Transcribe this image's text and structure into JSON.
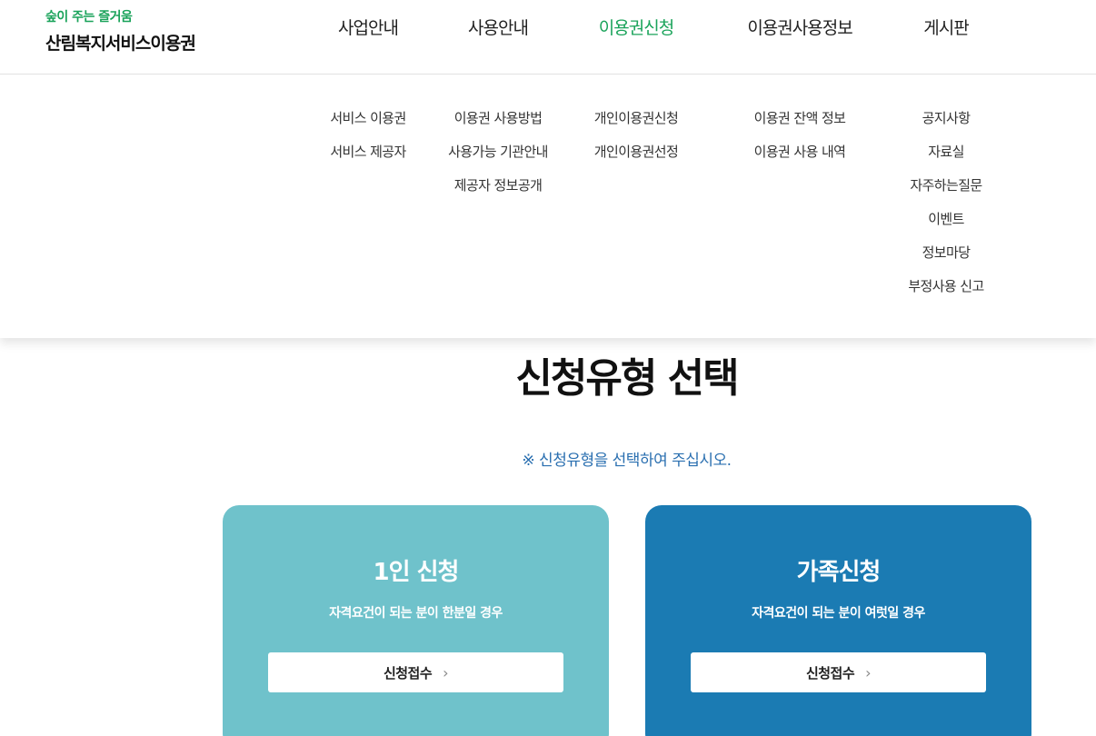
{
  "logo": {
    "sub": "숲이 주는 즐거움",
    "main": "산림복지서비스이용권"
  },
  "nav": [
    {
      "label": "사업안내",
      "subs": [
        "서비스 이용권",
        "서비스 제공자"
      ]
    },
    {
      "label": "사용안내",
      "subs": [
        "이용권 사용방법",
        "사용가능 기관안내",
        "제공자 정보공개"
      ]
    },
    {
      "label": "이용권신청",
      "subs": [
        "개인이용권신청",
        "개인이용권선정"
      ]
    },
    {
      "label": "이용권사용정보",
      "subs": [
        "이용권 잔액 정보",
        "이용권 사용 내역"
      ]
    },
    {
      "label": "게시판",
      "subs": [
        "공지사항",
        "자료실",
        "자주하는질문",
        "이벤트",
        "정보마당",
        "부정사용 신고"
      ]
    }
  ],
  "active_nav": "이용권신청",
  "page": {
    "title": "신청유형 선택",
    "notice": "※ 신청유형을 선택하여 주십시오."
  },
  "cards": [
    {
      "title": "1인 신청",
      "desc": "자격요건이 되는 분이 한분일 경우",
      "button": "신청접수"
    },
    {
      "title": "가족신청",
      "desc": "자격요건이 되는 분이 여럿일 경우",
      "button": "신청접수"
    }
  ],
  "colors": {
    "brand_green": "#1aa35a",
    "card_light": "#6fc2cb",
    "card_dark": "#1b7bb3",
    "notice_blue": "#2a6fb0"
  },
  "icons": {
    "button_arrow": "chevron-right-icon"
  }
}
